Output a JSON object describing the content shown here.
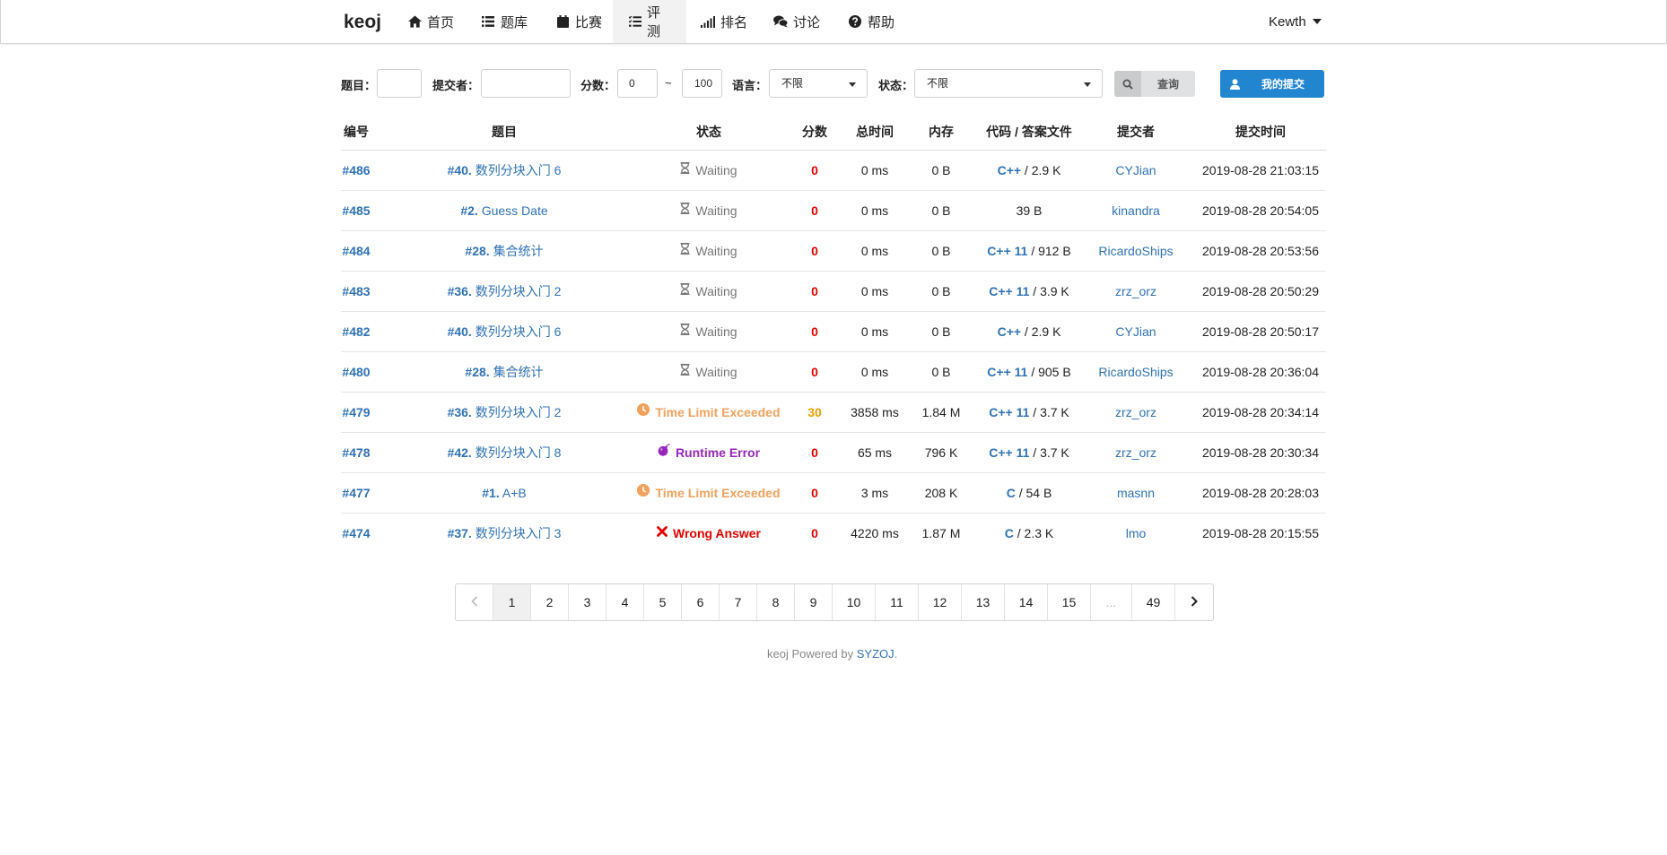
{
  "nav": {
    "brand": "keoj",
    "items": [
      {
        "label": "首页",
        "icon": "home-icon"
      },
      {
        "label": "题库",
        "icon": "list-icon"
      },
      {
        "label": "比赛",
        "icon": "calendar-icon"
      },
      {
        "label": "评测",
        "icon": "tasks-icon"
      },
      {
        "label": "排名",
        "icon": "signal-icon"
      },
      {
        "label": "讨论",
        "icon": "comments-icon"
      },
      {
        "label": "帮助",
        "icon": "question-circle-icon"
      }
    ],
    "user": "Kewth"
  },
  "filter": {
    "problem_label": "题目：",
    "problem_value": "",
    "submitter_label": "提交者：",
    "submitter_value": "",
    "score_label": "分数：",
    "score_min": "0",
    "tilde": "~",
    "score_max": "100",
    "language_label": "语言：",
    "language_value": "不限",
    "status_label": "状态：",
    "status_value": "不限",
    "search_button": "查询",
    "my_submissions_button": "我的提交"
  },
  "table": {
    "headers": [
      "编号",
      "题目",
      "状态",
      "分数",
      "总时间",
      "内存",
      "代码 / 答案文件",
      "提交者",
      "提交时间"
    ],
    "rows": [
      {
        "id": "#486",
        "pid": "#40.",
        "pname": "数列分块入门 6",
        "status": "Waiting",
        "score": "0",
        "time": "0 ms",
        "mem": "0 B",
        "lang": "C++",
        "size": "2.9 K",
        "user": "CYJian",
        "submit_time": "2019-08-28 21:03:15"
      },
      {
        "id": "#485",
        "pid": "#2.",
        "pname": "Guess Date",
        "status": "Waiting",
        "score": "0",
        "time": "0 ms",
        "mem": "0 B",
        "lang": "",
        "size": "39 B",
        "user": "kinandra",
        "submit_time": "2019-08-28 20:54:05"
      },
      {
        "id": "#484",
        "pid": "#28.",
        "pname": "集合统计",
        "status": "Waiting",
        "score": "0",
        "time": "0 ms",
        "mem": "0 B",
        "lang": "C++ 11",
        "size": "912 B",
        "user": "RicardoShips",
        "submit_time": "2019-08-28 20:53:56"
      },
      {
        "id": "#483",
        "pid": "#36.",
        "pname": "数列分块入门 2",
        "status": "Waiting",
        "score": "0",
        "time": "0 ms",
        "mem": "0 B",
        "lang": "C++ 11",
        "size": "3.9 K",
        "user": "zrz_orz",
        "submit_time": "2019-08-28 20:50:29"
      },
      {
        "id": "#482",
        "pid": "#40.",
        "pname": "数列分块入门 6",
        "status": "Waiting",
        "score": "0",
        "time": "0 ms",
        "mem": "0 B",
        "lang": "C++",
        "size": "2.9 K",
        "user": "CYJian",
        "submit_time": "2019-08-28 20:50:17"
      },
      {
        "id": "#480",
        "pid": "#28.",
        "pname": "集合统计",
        "status": "Waiting",
        "score": "0",
        "time": "0 ms",
        "mem": "0 B",
        "lang": "C++ 11",
        "size": "905 B",
        "user": "RicardoShips",
        "submit_time": "2019-08-28 20:36:04"
      },
      {
        "id": "#479",
        "pid": "#36.",
        "pname": "数列分块入门 2",
        "status": "Time Limit Exceeded",
        "score": "30",
        "time": "3858 ms",
        "mem": "1.84 M",
        "lang": "C++ 11",
        "size": "3.7 K",
        "user": "zrz_orz",
        "submit_time": "2019-08-28 20:34:14"
      },
      {
        "id": "#478",
        "pid": "#42.",
        "pname": "数列分块入门 8",
        "status": "Runtime Error",
        "score": "0",
        "time": "65 ms",
        "mem": "796 K",
        "lang": "C++ 11",
        "size": "3.7 K",
        "user": "zrz_orz",
        "submit_time": "2019-08-28 20:30:34"
      },
      {
        "id": "#477",
        "pid": "#1.",
        "pname": "A+B",
        "status": "Time Limit Exceeded",
        "score": "0",
        "time": "3 ms",
        "mem": "208 K",
        "lang": "C",
        "size": "54 B",
        "user": "masnn",
        "submit_time": "2019-08-28 20:28:03"
      },
      {
        "id": "#474",
        "pid": "#37.",
        "pname": "数列分块入门 3",
        "status": "Wrong Answer",
        "score": "0",
        "time": "4220 ms",
        "mem": "1.87 M",
        "lang": "C",
        "size": "2.3 K",
        "user": "lmo",
        "submit_time": "2019-08-28 20:15:55"
      }
    ]
  },
  "status_styles": {
    "Waiting": {
      "color": "#767676",
      "icon": "hourglass-icon"
    },
    "Time Limit Exceeded": {
      "color": "#f2a15c",
      "icon": "clock-icon"
    },
    "Runtime Error": {
      "color": "#9627ba",
      "icon": "bomb-icon"
    },
    "Wrong Answer": {
      "color": "#e60000",
      "icon": "times-icon"
    }
  },
  "score_colors": {
    "0": "#e60000",
    "30": "#e6a100"
  },
  "pagination": {
    "current": "1",
    "pages": [
      "1",
      "2",
      "3",
      "4",
      "5",
      "6",
      "7",
      "8",
      "9",
      "10",
      "11",
      "12",
      "13",
      "14",
      "15",
      "...",
      "49"
    ]
  },
  "footer": {
    "prefix": "keoj Powered by",
    "link": "SYZOJ",
    "suffix": "."
  }
}
